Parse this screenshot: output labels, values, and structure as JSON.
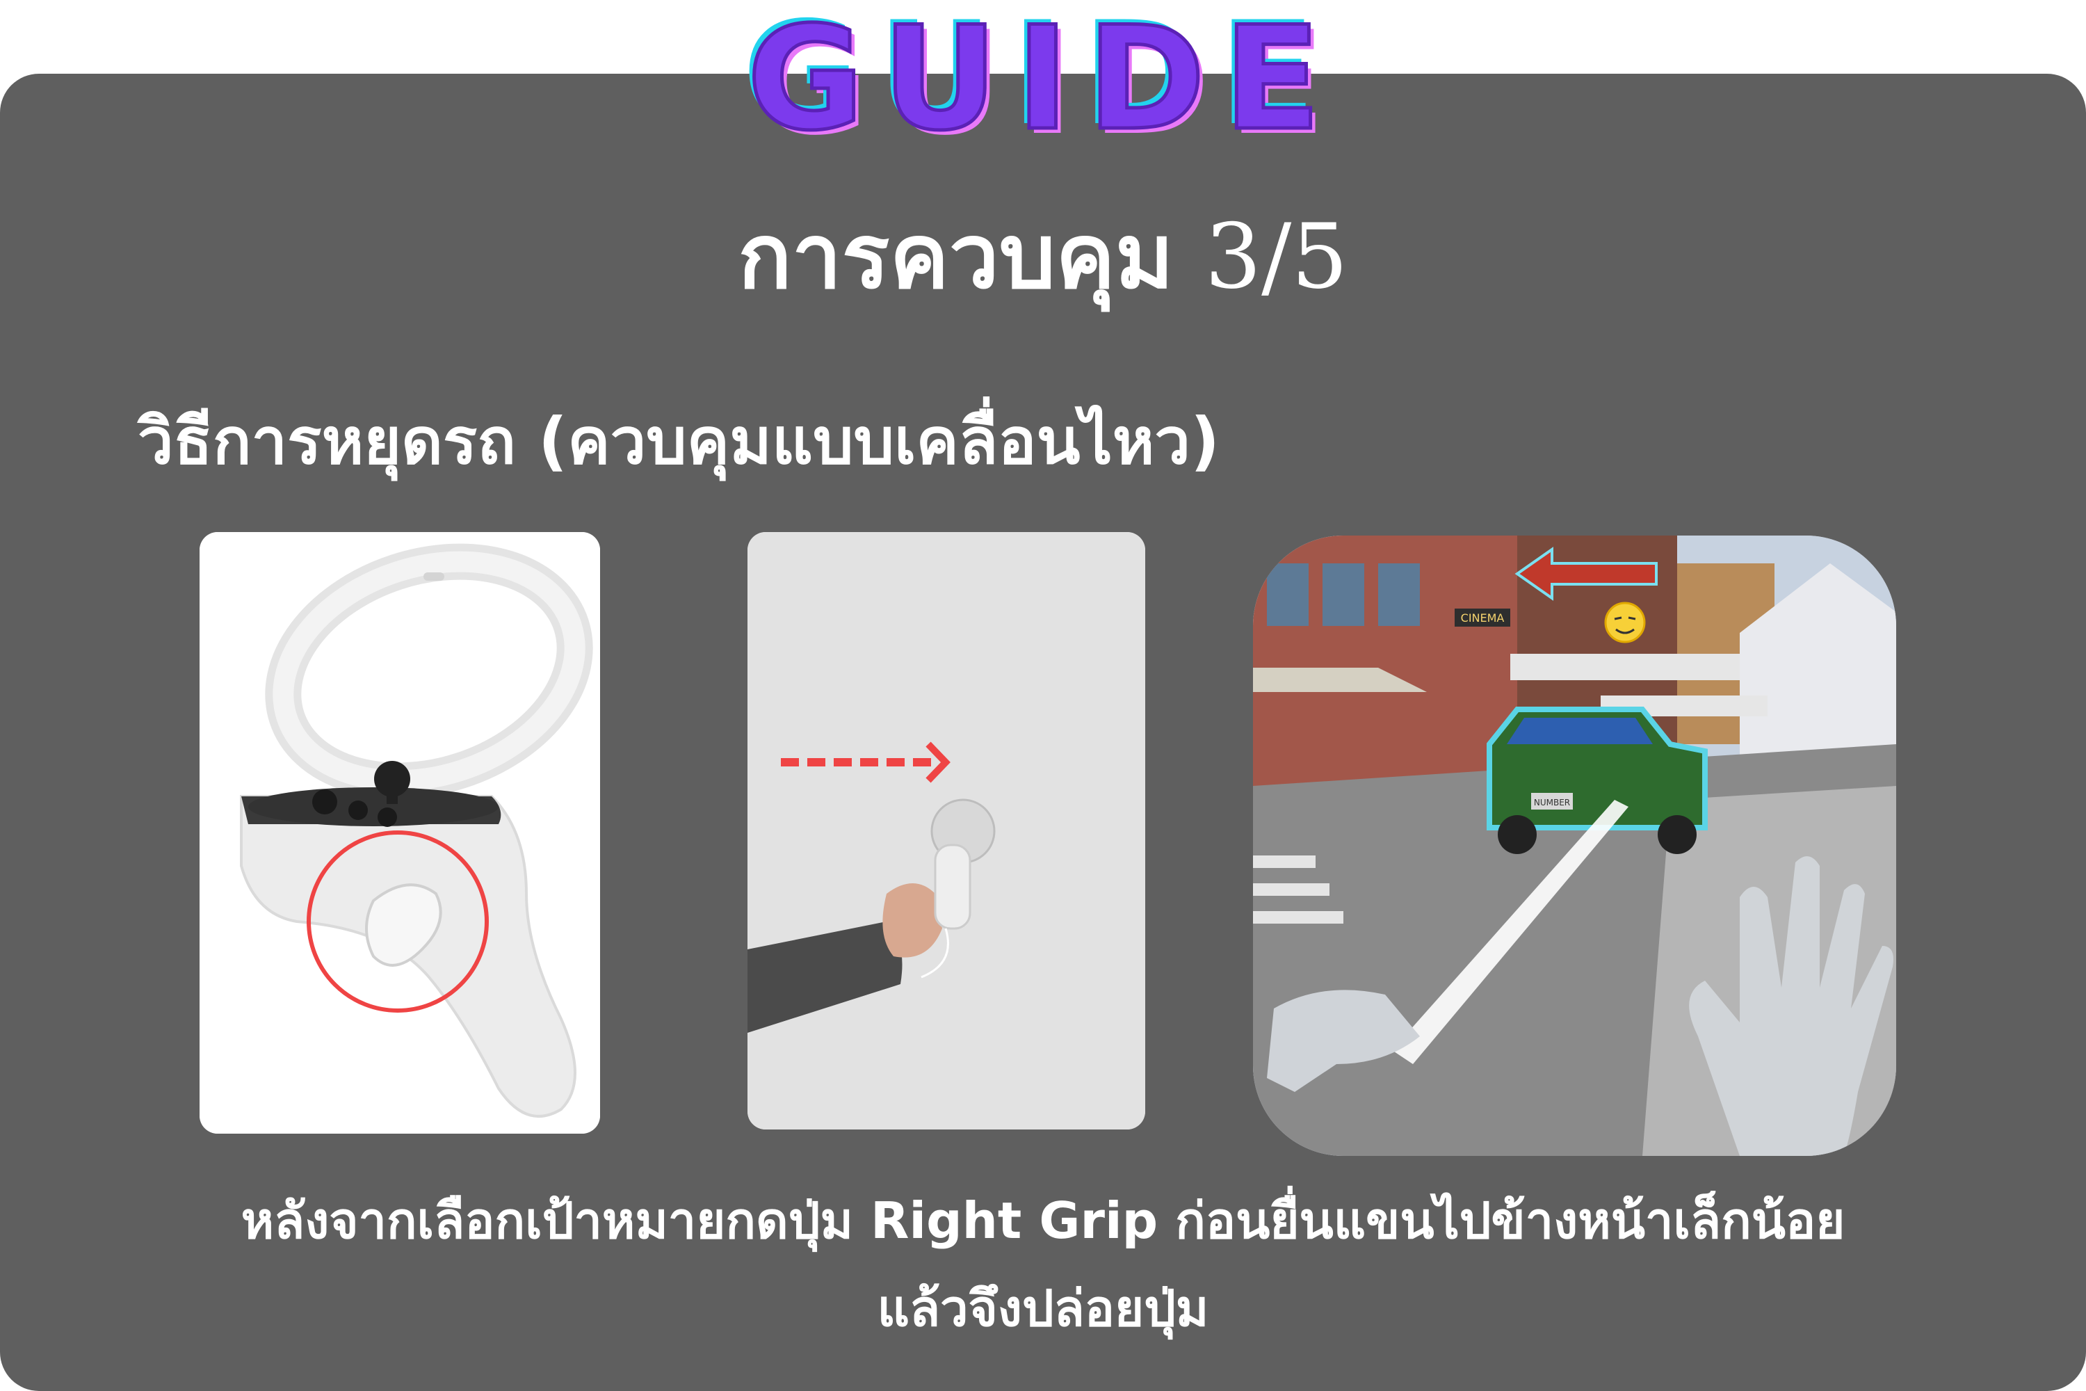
{
  "title": "GUIDE",
  "heading": {
    "text": "การควบคุม",
    "step": "3/5"
  },
  "subheading": "วิธีการหยุดรถ (ควบคุมแบบเคลื่อนไหว)",
  "images": [
    {
      "name": "controller-grip-photo",
      "icon": "vr-controller-icon"
    },
    {
      "name": "hand-motion-photo",
      "icon": "dotted-arrow-right-icon"
    },
    {
      "name": "game-scene-screenshot",
      "icon": "car-target-icon",
      "sign_text": "CINEMA",
      "plate_text": "NUMBER"
    }
  ],
  "caption": {
    "line1": "หลังจากเลือกเป้าหมายกดปุ่ม Right Grip ก่อนยื่นแขนไปข้างหน้าเล็กน้อย",
    "line2": "แล้วจึงปล่อยปุ่ม"
  },
  "colors": {
    "panel": "#5f5f5f",
    "title_fill": "#7c3aed",
    "title_outline": "#22d3ee",
    "highlight_red": "#ef4444"
  }
}
